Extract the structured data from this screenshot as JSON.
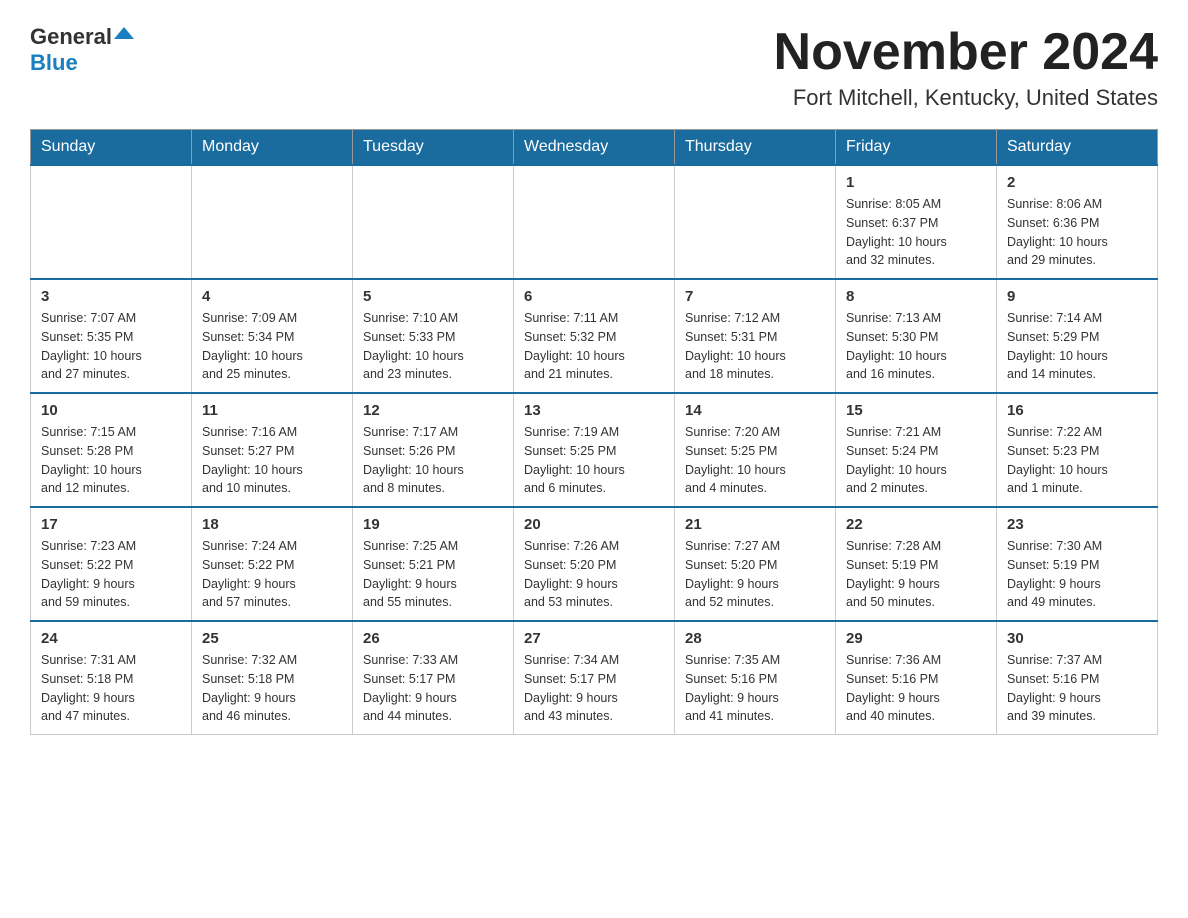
{
  "logo": {
    "general": "General",
    "blue": "Blue"
  },
  "title": "November 2024",
  "location": "Fort Mitchell, Kentucky, United States",
  "days_of_week": [
    "Sunday",
    "Monday",
    "Tuesday",
    "Wednesday",
    "Thursday",
    "Friday",
    "Saturday"
  ],
  "weeks": [
    [
      {
        "day": "",
        "info": ""
      },
      {
        "day": "",
        "info": ""
      },
      {
        "day": "",
        "info": ""
      },
      {
        "day": "",
        "info": ""
      },
      {
        "day": "",
        "info": ""
      },
      {
        "day": "1",
        "info": "Sunrise: 8:05 AM\nSunset: 6:37 PM\nDaylight: 10 hours\nand 32 minutes."
      },
      {
        "day": "2",
        "info": "Sunrise: 8:06 AM\nSunset: 6:36 PM\nDaylight: 10 hours\nand 29 minutes."
      }
    ],
    [
      {
        "day": "3",
        "info": "Sunrise: 7:07 AM\nSunset: 5:35 PM\nDaylight: 10 hours\nand 27 minutes."
      },
      {
        "day": "4",
        "info": "Sunrise: 7:09 AM\nSunset: 5:34 PM\nDaylight: 10 hours\nand 25 minutes."
      },
      {
        "day": "5",
        "info": "Sunrise: 7:10 AM\nSunset: 5:33 PM\nDaylight: 10 hours\nand 23 minutes."
      },
      {
        "day": "6",
        "info": "Sunrise: 7:11 AM\nSunset: 5:32 PM\nDaylight: 10 hours\nand 21 minutes."
      },
      {
        "day": "7",
        "info": "Sunrise: 7:12 AM\nSunset: 5:31 PM\nDaylight: 10 hours\nand 18 minutes."
      },
      {
        "day": "8",
        "info": "Sunrise: 7:13 AM\nSunset: 5:30 PM\nDaylight: 10 hours\nand 16 minutes."
      },
      {
        "day": "9",
        "info": "Sunrise: 7:14 AM\nSunset: 5:29 PM\nDaylight: 10 hours\nand 14 minutes."
      }
    ],
    [
      {
        "day": "10",
        "info": "Sunrise: 7:15 AM\nSunset: 5:28 PM\nDaylight: 10 hours\nand 12 minutes."
      },
      {
        "day": "11",
        "info": "Sunrise: 7:16 AM\nSunset: 5:27 PM\nDaylight: 10 hours\nand 10 minutes."
      },
      {
        "day": "12",
        "info": "Sunrise: 7:17 AM\nSunset: 5:26 PM\nDaylight: 10 hours\nand 8 minutes."
      },
      {
        "day": "13",
        "info": "Sunrise: 7:19 AM\nSunset: 5:25 PM\nDaylight: 10 hours\nand 6 minutes."
      },
      {
        "day": "14",
        "info": "Sunrise: 7:20 AM\nSunset: 5:25 PM\nDaylight: 10 hours\nand 4 minutes."
      },
      {
        "day": "15",
        "info": "Sunrise: 7:21 AM\nSunset: 5:24 PM\nDaylight: 10 hours\nand 2 minutes."
      },
      {
        "day": "16",
        "info": "Sunrise: 7:22 AM\nSunset: 5:23 PM\nDaylight: 10 hours\nand 1 minute."
      }
    ],
    [
      {
        "day": "17",
        "info": "Sunrise: 7:23 AM\nSunset: 5:22 PM\nDaylight: 9 hours\nand 59 minutes."
      },
      {
        "day": "18",
        "info": "Sunrise: 7:24 AM\nSunset: 5:22 PM\nDaylight: 9 hours\nand 57 minutes."
      },
      {
        "day": "19",
        "info": "Sunrise: 7:25 AM\nSunset: 5:21 PM\nDaylight: 9 hours\nand 55 minutes."
      },
      {
        "day": "20",
        "info": "Sunrise: 7:26 AM\nSunset: 5:20 PM\nDaylight: 9 hours\nand 53 minutes."
      },
      {
        "day": "21",
        "info": "Sunrise: 7:27 AM\nSunset: 5:20 PM\nDaylight: 9 hours\nand 52 minutes."
      },
      {
        "day": "22",
        "info": "Sunrise: 7:28 AM\nSunset: 5:19 PM\nDaylight: 9 hours\nand 50 minutes."
      },
      {
        "day": "23",
        "info": "Sunrise: 7:30 AM\nSunset: 5:19 PM\nDaylight: 9 hours\nand 49 minutes."
      }
    ],
    [
      {
        "day": "24",
        "info": "Sunrise: 7:31 AM\nSunset: 5:18 PM\nDaylight: 9 hours\nand 47 minutes."
      },
      {
        "day": "25",
        "info": "Sunrise: 7:32 AM\nSunset: 5:18 PM\nDaylight: 9 hours\nand 46 minutes."
      },
      {
        "day": "26",
        "info": "Sunrise: 7:33 AM\nSunset: 5:17 PM\nDaylight: 9 hours\nand 44 minutes."
      },
      {
        "day": "27",
        "info": "Sunrise: 7:34 AM\nSunset: 5:17 PM\nDaylight: 9 hours\nand 43 minutes."
      },
      {
        "day": "28",
        "info": "Sunrise: 7:35 AM\nSunset: 5:16 PM\nDaylight: 9 hours\nand 41 minutes."
      },
      {
        "day": "29",
        "info": "Sunrise: 7:36 AM\nSunset: 5:16 PM\nDaylight: 9 hours\nand 40 minutes."
      },
      {
        "day": "30",
        "info": "Sunrise: 7:37 AM\nSunset: 5:16 PM\nDaylight: 9 hours\nand 39 minutes."
      }
    ]
  ]
}
